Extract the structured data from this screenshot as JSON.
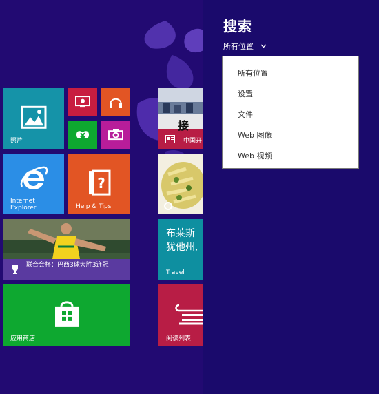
{
  "tiles": {
    "photos": {
      "label": "照片",
      "color": "#1593a8"
    },
    "ie": {
      "label_line1": "Internet",
      "label_line2": "Explorer",
      "color": "#2b8ee6"
    },
    "help": {
      "label": "Help & Tips",
      "color": "#e25524"
    },
    "sports": {
      "caption": "联合会杯：巴西3球大胜3连冠",
      "color": "#5a3aa0"
    },
    "store": {
      "label": "应用商店",
      "color": "#0ea830"
    },
    "news": {
      "caption": "中国开",
      "banner": "接"
    },
    "travel": {
      "line1": "布莱斯",
      "line2": "犹他州,",
      "label": "Travel",
      "color": "#0e8fa0"
    },
    "reading": {
      "label": "阅读列表",
      "color": "#b81d45"
    },
    "small_red": {
      "color": "#c81d40"
    },
    "small_orange": {
      "color": "#e25524"
    },
    "small_green": {
      "color": "#0ea830"
    },
    "small_magenta": {
      "color": "#b81d9a"
    }
  },
  "search": {
    "title": "搜索",
    "scope": "所有位置",
    "options": [
      "所有位置",
      "设置",
      "文件",
      "Web 图像",
      "Web 视频"
    ]
  }
}
